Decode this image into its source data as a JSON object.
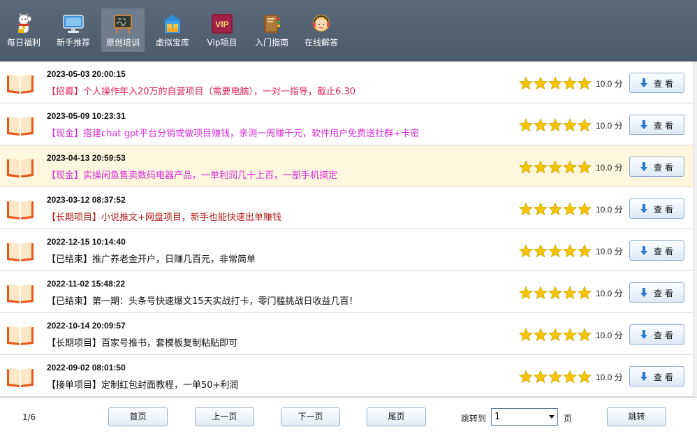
{
  "toolbar": {
    "items": [
      {
        "label": "每日福利",
        "icon": "lucky-cat-icon"
      },
      {
        "label": "新手推荐",
        "icon": "monitor-icon"
      },
      {
        "label": "原创培训",
        "icon": "blackboard-icon",
        "active": true
      },
      {
        "label": "虚拟宝库",
        "icon": "warehouse-icon"
      },
      {
        "label": "Vip项目",
        "icon": "vip-icon",
        "badge": "VIP"
      },
      {
        "label": "入门指南",
        "icon": "guide-book-icon"
      },
      {
        "label": "在线解答",
        "icon": "support-agent-icon"
      }
    ]
  },
  "list": {
    "rows": [
      {
        "date": "2023-05-03 20:00:15",
        "title": "【招募】个人操作年入20万的自营项目（需要电脑），一对一指导，截止6.30",
        "title_color": "#e0245e",
        "rating": 5,
        "score": "10.0 分",
        "button": "查 看"
      },
      {
        "date": "2023-05-09 10:23:31",
        "title": "【现金】搭建chat gpt平台分销或做项目赚钱，亲测一周赚千元，软件用户免费送社群+卡密",
        "title_color": "#d62fd6",
        "rating": 5,
        "score": "10.0 分",
        "button": "查 看"
      },
      {
        "date": "2023-04-13 20:59:53",
        "title": "【现金】实操闲鱼售卖数码电器产品，一单利润几十上百，一部手机搞定",
        "title_color": "#d62fd6",
        "rating": 5,
        "score": "10.0 分",
        "button": "查 看",
        "highlighted": true
      },
      {
        "date": "2023-03-12 08:37:52",
        "title": "【长期项目】小说推文+网盘项目，新手也能快速出单赚钱",
        "title_color": "#b01e1e",
        "rating": 5,
        "score": "10.0 分",
        "button": "查 看"
      },
      {
        "date": "2022-12-15 10:14:40",
        "title": "【已结束】推广养老金开户，日赚几百元，非常简单",
        "title_color": "#111111",
        "rating": 5,
        "score": "10.0 分",
        "button": "查 看"
      },
      {
        "date": "2022-11-02 15:48:22",
        "title": "【已结束】第一期：头条号快速爆文15天实战打卡，零门槛挑战日收益几百！",
        "title_color": "#111111",
        "rating": 5,
        "score": "10.0 分",
        "button": "查 看"
      },
      {
        "date": "2022-10-14 20:09:57",
        "title": "【长期项目】百家号推书，套模板复制粘贴即可",
        "title_color": "#111111",
        "rating": 5,
        "score": "10.0 分",
        "button": "查 看"
      },
      {
        "date": "2022-09-02 08:01:50",
        "title": "【接单项目】定制红包封面教程，一单50+利润",
        "title_color": "#111111",
        "rating": 5,
        "score": "10.0 分",
        "button": "查 看"
      }
    ]
  },
  "pager": {
    "page_info": "1/6",
    "first": "首页",
    "prev": "上一页",
    "next": "下一页",
    "last": "尾页",
    "jump_label": "跳转到",
    "jump_value": "1",
    "page_unit": "页",
    "jump_button": "跳转"
  },
  "colors": {
    "toolbar_bg": "#4f5f6f",
    "star": "#f5c400",
    "book": "#e8581c",
    "highlight_row": "#fff6de"
  }
}
